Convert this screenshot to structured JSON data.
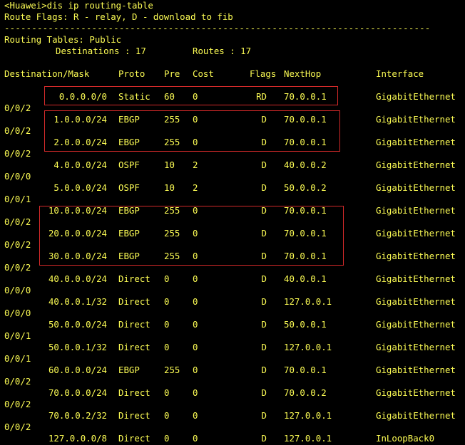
{
  "terminal": {
    "lines": [
      "<Huawei>dis ip routing-table",
      "Route Flags: R - relay, D - download to fib",
      "------------------------------------------------------------------------------"
    ],
    "table_title": "Routing Tables: Public",
    "destinations_label": "Destinations : 17",
    "routes_label": "Routes : 17"
  },
  "table": {
    "headers": {
      "destination": "Destination/Mask",
      "proto": "Proto",
      "pre": "Pre",
      "cost": "Cost",
      "flags": "Flags",
      "nexthop": "NextHop",
      "interface": "Interface"
    },
    "rows": [
      {
        "dest": "0.0.0.0/0",
        "proto": "Static",
        "pre": "60",
        "cost": "0",
        "flags": "RD",
        "nexthop": "70.0.0.1",
        "iface": "GigabitEthernet",
        "iface_cont": "0/0/2"
      },
      {
        "dest": "1.0.0.0/24",
        "proto": "EBGP",
        "pre": "255",
        "cost": "0",
        "flags": "D",
        "nexthop": "70.0.0.1",
        "iface": "GigabitEthernet",
        "iface_cont": "0/0/2"
      },
      {
        "dest": "2.0.0.0/24",
        "proto": "EBGP",
        "pre": "255",
        "cost": "0",
        "flags": "D",
        "nexthop": "70.0.0.1",
        "iface": "GigabitEthernet",
        "iface_cont": "0/0/2"
      },
      {
        "dest": "4.0.0.0/24",
        "proto": "OSPF",
        "pre": "10",
        "cost": "2",
        "flags": "D",
        "nexthop": "40.0.0.2",
        "iface": "GigabitEthernet",
        "iface_cont": "0/0/0"
      },
      {
        "dest": "5.0.0.0/24",
        "proto": "OSPF",
        "pre": "10",
        "cost": "2",
        "flags": "D",
        "nexthop": "50.0.0.2",
        "iface": "GigabitEthernet",
        "iface_cont": "0/0/1"
      },
      {
        "dest": "10.0.0.0/24",
        "proto": "EBGP",
        "pre": "255",
        "cost": "0",
        "flags": "D",
        "nexthop": "70.0.0.1",
        "iface": "GigabitEthernet",
        "iface_cont": "0/0/2"
      },
      {
        "dest": "20.0.0.0/24",
        "proto": "EBGP",
        "pre": "255",
        "cost": "0",
        "flags": "D",
        "nexthop": "70.0.0.1",
        "iface": "GigabitEthernet",
        "iface_cont": "0/0/2"
      },
      {
        "dest": "30.0.0.0/24",
        "proto": "EBGP",
        "pre": "255",
        "cost": "0",
        "flags": "D",
        "nexthop": "70.0.0.1",
        "iface": "GigabitEthernet",
        "iface_cont": "0/0/2"
      },
      {
        "dest": "40.0.0.0/24",
        "proto": "Direct",
        "pre": "0",
        "cost": "0",
        "flags": "D",
        "nexthop": "40.0.0.1",
        "iface": "GigabitEthernet",
        "iface_cont": "0/0/0"
      },
      {
        "dest": "40.0.0.1/32",
        "proto": "Direct",
        "pre": "0",
        "cost": "0",
        "flags": "D",
        "nexthop": "127.0.0.1",
        "iface": "GigabitEthernet",
        "iface_cont": "0/0/0"
      },
      {
        "dest": "50.0.0.0/24",
        "proto": "Direct",
        "pre": "0",
        "cost": "0",
        "flags": "D",
        "nexthop": "50.0.0.1",
        "iface": "GigabitEthernet",
        "iface_cont": "0/0/1"
      },
      {
        "dest": "50.0.0.1/32",
        "proto": "Direct",
        "pre": "0",
        "cost": "0",
        "flags": "D",
        "nexthop": "127.0.0.1",
        "iface": "GigabitEthernet",
        "iface_cont": "0/0/1"
      },
      {
        "dest": "60.0.0.0/24",
        "proto": "EBGP",
        "pre": "255",
        "cost": "0",
        "flags": "D",
        "nexthop": "70.0.0.1",
        "iface": "GigabitEthernet",
        "iface_cont": "0/0/2"
      },
      {
        "dest": "70.0.0.0/24",
        "proto": "Direct",
        "pre": "0",
        "cost": "0",
        "flags": "D",
        "nexthop": "70.0.0.2",
        "iface": "GigabitEthernet",
        "iface_cont": "0/0/2"
      },
      {
        "dest": "70.0.0.2/32",
        "proto": "Direct",
        "pre": "0",
        "cost": "0",
        "flags": "D",
        "nexthop": "127.0.0.1",
        "iface": "GigabitEthernet",
        "iface_cont": "0/0/2"
      },
      {
        "dest": "127.0.0.0/8",
        "proto": "Direct",
        "pre": "0",
        "cost": "0",
        "flags": "D",
        "nexthop": "127.0.0.1",
        "iface": "InLoopBack0",
        "iface_cont": ""
      }
    ]
  },
  "colors": {
    "text": "#fcfc54",
    "background": "#000000",
    "highlight_box": "#d42a2a"
  }
}
